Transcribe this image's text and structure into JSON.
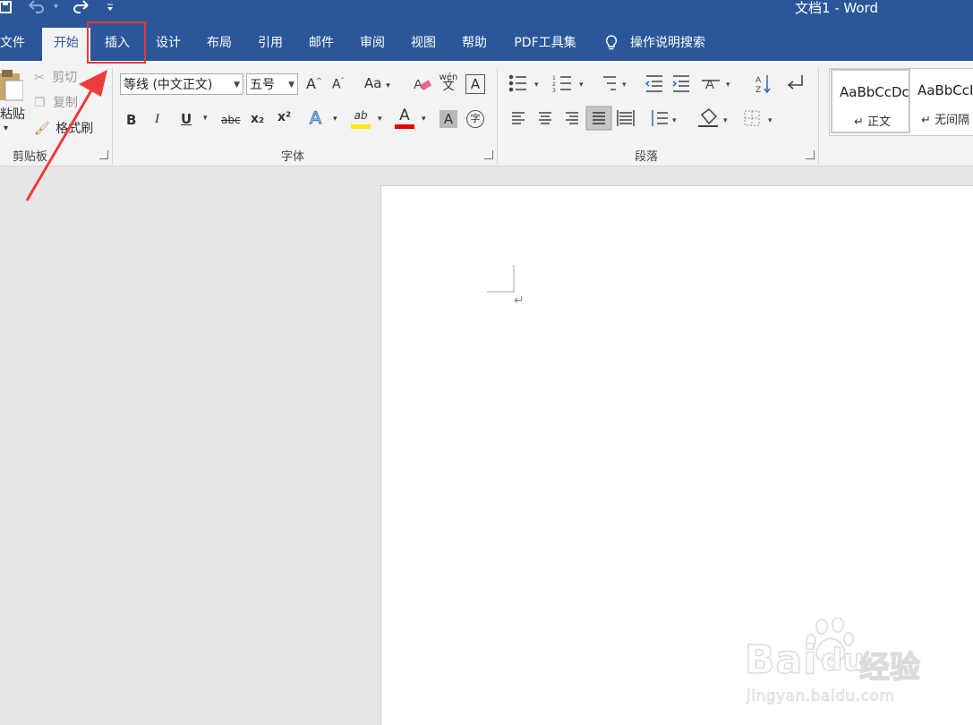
{
  "titlebar": {
    "doc_title": "文档1  -  Word",
    "qat": {
      "save_icon": "save-icon",
      "undo_icon": "undo-icon",
      "redo_icon": "redo-icon",
      "customize": "⌄"
    }
  },
  "tabs": [
    {
      "label": "文件"
    },
    {
      "label": "开始",
      "active": true
    },
    {
      "label": "插入"
    },
    {
      "label": "设计"
    },
    {
      "label": "布局"
    },
    {
      "label": "引用"
    },
    {
      "label": "邮件"
    },
    {
      "label": "审阅"
    },
    {
      "label": "视图"
    },
    {
      "label": "帮助"
    },
    {
      "label": "PDF工具集"
    }
  ],
  "tellme": {
    "label": "操作说明搜索"
  },
  "clipboard": {
    "paste_label": "粘贴",
    "cut_label": "剪切",
    "copy_label": "复制",
    "format_painter_label": "格式刷",
    "group_label": "剪贴板"
  },
  "font": {
    "font_name": "等线 (中文正文)",
    "font_size": "五号",
    "grow": "A",
    "shrink": "A",
    "change_case": "Aa",
    "phonetic": "wén",
    "bold": "B",
    "italic": "I",
    "underline": "U",
    "strikethrough": "abc",
    "subscript": "x₂",
    "superscript": "x²",
    "text_effects": "A",
    "highlight": "ab",
    "font_color": "A",
    "char_shading": "A",
    "enclose": "字",
    "group_label": "字体",
    "highlight_color": "#ffeb00",
    "font_color_value": "#e00000"
  },
  "paragraph": {
    "group_label": "段落",
    "sort": "A↓Z"
  },
  "styles": {
    "items": [
      {
        "sample": "AaBbCcDc",
        "name": "↵ 正文"
      },
      {
        "sample": "AaBbCcI",
        "name": "↵ 无间隔"
      }
    ]
  },
  "document": {
    "paragraph_mark": "↵"
  },
  "annotation": {
    "highlight_color": "#e53935"
  },
  "watermark": {
    "brand_left": "Bai",
    "brand_right": "经验",
    "brand_du": "du",
    "url": "jingyan.baidu.com"
  }
}
